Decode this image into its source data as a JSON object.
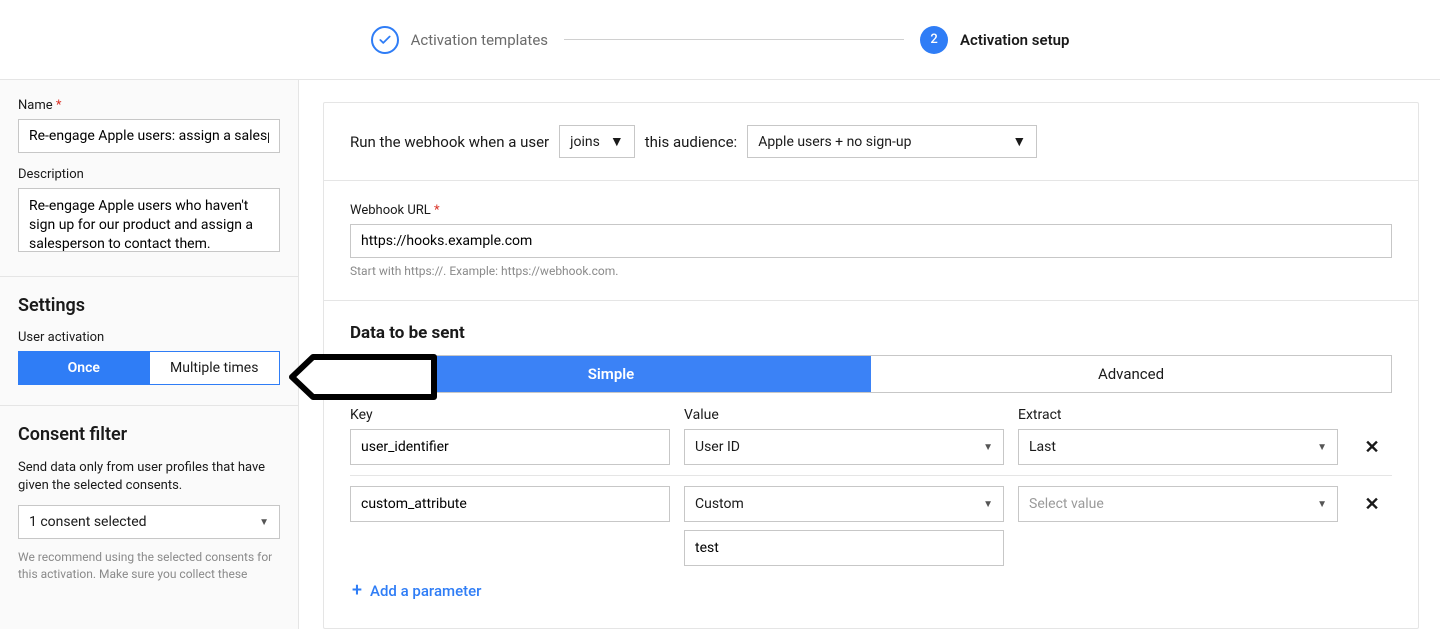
{
  "stepper": {
    "step1": "Activation templates",
    "step2_num": "2",
    "step2": "Activation setup"
  },
  "sidebar": {
    "name_label": "Name",
    "name_value": "Re-engage Apple users: assign a salesperson",
    "desc_label": "Description",
    "desc_value": "Re-engage Apple users who haven't sign up for our product and assign a salesperson to contact them.",
    "settings_heading": "Settings",
    "activation_label": "User activation",
    "activation_once": "Once",
    "activation_multi": "Multiple times",
    "consent_heading": "Consent filter",
    "consent_sub": "Send data only from user profiles that have given the selected consents.",
    "consent_selected": "1 consent selected",
    "consent_note": "We recommend using the selected consents for this activation. Make sure you collect these"
  },
  "main": {
    "rule_prefix": "Run the webhook when a user",
    "trigger": "joins",
    "rule_mid": "this audience:",
    "audience": "Apple users + no sign-up",
    "url_label": "Webhook URL",
    "url_value": "https://hooks.example.com",
    "url_helper": "Start with https://. Example: https://webhook.com.",
    "data_heading": "Data to be sent",
    "tab_simple": "Simple",
    "tab_advanced": "Advanced",
    "col_key": "Key",
    "col_value": "Value",
    "col_extract": "Extract",
    "rows": [
      {
        "key": "user_identifier",
        "value": "User ID",
        "extract": "Last",
        "custom_text": ""
      },
      {
        "key": "custom_attribute",
        "value": "Custom",
        "extract_placeholder": "Select value",
        "custom_text": "test"
      }
    ],
    "add_label": "Add a parameter"
  }
}
